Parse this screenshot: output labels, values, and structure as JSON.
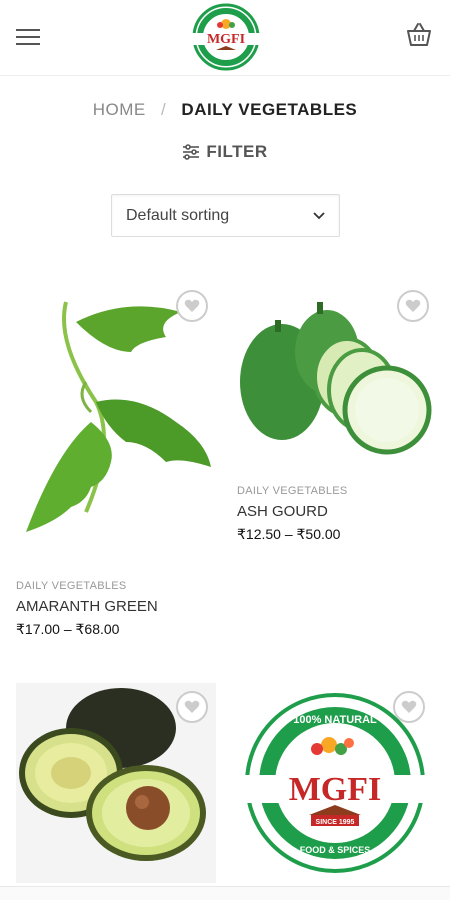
{
  "header": {
    "logo_text": "MGFI",
    "logo_tagline_top": "100% NATURAL",
    "logo_tagline_bottom": "FOOD & SPICES",
    "logo_since": "SINCE 1995"
  },
  "breadcrumb": {
    "home": "HOME",
    "separator": "/",
    "current": "DAILY VEGETABLES"
  },
  "filter": {
    "label": "FILTER"
  },
  "sorting": {
    "selected": "Default sorting"
  },
  "products": [
    {
      "category": "DAILY VEGETABLES",
      "name": "AMARANTH GREEN",
      "price": "₹17.00 – ₹68.00"
    },
    {
      "category": "DAILY VEGETABLES",
      "name": "ASH GOURD",
      "price": "₹12.50 – ₹50.00"
    },
    {
      "category": "",
      "name": "",
      "price": ""
    },
    {
      "category": "",
      "name": "",
      "price": ""
    }
  ],
  "colors": {
    "brand_green": "#1e9e4a",
    "brand_red": "#c62828",
    "text_dark": "#222222",
    "text_muted": "#888888"
  },
  "icons": [
    "menu-icon",
    "cart-icon",
    "filter-icon",
    "chevron-down-icon",
    "heart-icon"
  ]
}
